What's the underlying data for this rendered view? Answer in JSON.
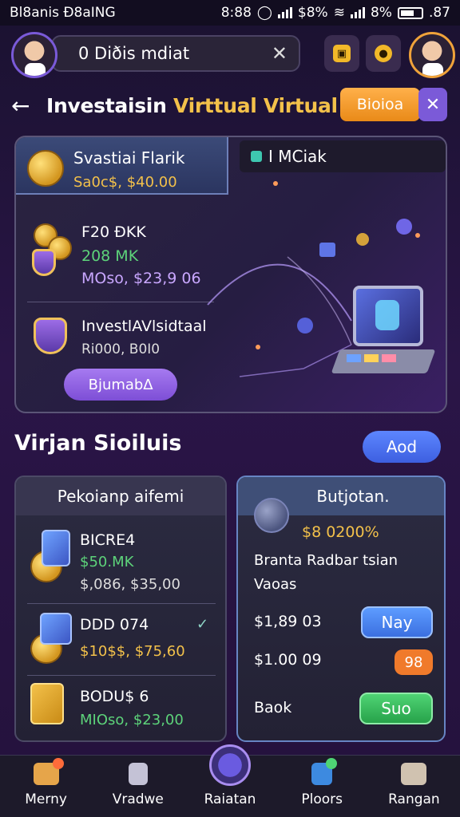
{
  "status_bar": {
    "app_name": "Bl8anis Ð8aING",
    "time": "8:88",
    "signal_text": "$8%",
    "battery_text": "8%",
    "extra": ".87"
  },
  "header": {
    "search_value": "0 Diðis mdiat",
    "clear_icon": "close-icon"
  },
  "page": {
    "title_main": "Investaisin ",
    "title_highlight": "Virttual Virtual",
    "orange_button": "Bioioa",
    "close_icon": "close-icon"
  },
  "featured": {
    "tab_label": "I MCiak",
    "header_name": "Svastiai Flarik",
    "header_value": "Sa0c$, $40.00",
    "item1_title": "F20 ÐKK",
    "item1_sub": "208 MK",
    "item1_price": "MOso, $23,9 06",
    "item2_title": "InvestlAVlsidtaal",
    "item2_sub": "Ri000, B0I0",
    "action_button": "Bjumab∆"
  },
  "section": {
    "title": "Virjan Sioiluis",
    "add_button": "Aod"
  },
  "left_card": {
    "title": "Pekoianp aifemi",
    "rows": [
      {
        "name": "BICRE4",
        "sub": "$50.MK",
        "price": "$,086, $35,00"
      },
      {
        "name": "DDD 074",
        "sub": "",
        "price": "$10$$, $75,60"
      },
      {
        "name": "BODU$ 6",
        "sub": "",
        "price": "MIOso, $23,00"
      }
    ]
  },
  "right_card": {
    "title": "Butjotan.",
    "value": "$8 0200%",
    "desc_line1": "Branta Radbar tsian",
    "desc_line2": "Vaoas",
    "row1_value": "$1,89 03",
    "row1_button": "Nay",
    "row2_value": "$1.00 09",
    "row2_badge": "98",
    "row3_label": "Baok",
    "row3_button": "Suo"
  },
  "nav": [
    {
      "label": "Merny",
      "icon": "home-icon"
    },
    {
      "label": "Vradwe",
      "icon": "chess-icon"
    },
    {
      "label": "Raiatan",
      "icon": "clock-icon"
    },
    {
      "label": "Ploors",
      "icon": "wallet-icon"
    },
    {
      "label": "Rangan",
      "icon": "house-icon"
    }
  ],
  "colors": {
    "accent_gold": "#f3c14a",
    "accent_purple": "#7d4ed6",
    "accent_blue": "#3d5fe0",
    "positive_green": "#5dd37a"
  }
}
